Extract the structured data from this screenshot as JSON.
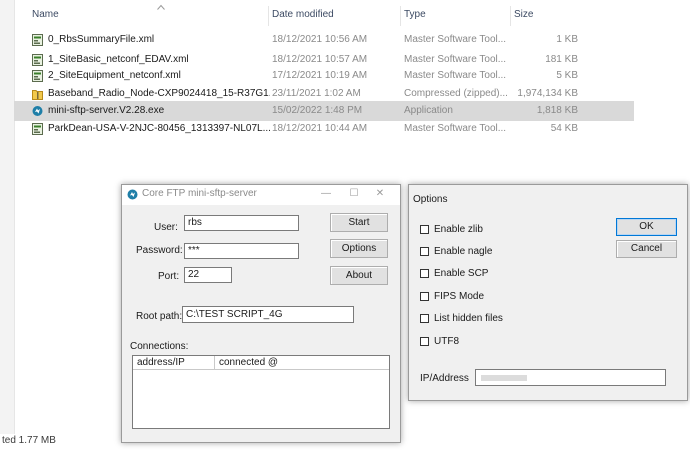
{
  "explorer": {
    "columns": {
      "name": "Name",
      "date": "Date modified",
      "type": "Type",
      "size": "Size"
    },
    "files": [
      {
        "name": "0_RbsSummaryFile.xml",
        "date": "18/12/2021 10:56 AM",
        "type": "Master Software Tool...",
        "size": "1 KB",
        "icon": "xml-file-icon"
      },
      {
        "name": "1_SiteBasic_netconf_EDAV.xml",
        "date": "18/12/2021 10:57 AM",
        "type": "Master Software Tool...",
        "size": "181 KB",
        "icon": "xml-file-icon"
      },
      {
        "name": "2_SiteEquipment_netconf.xml",
        "date": "17/12/2021 10:19 AM",
        "type": "Master Software Tool...",
        "size": "5 KB",
        "icon": "xml-file-icon"
      },
      {
        "name": "Baseband_Radio_Node-CXP9024418_15-R37G1...",
        "date": "23/11/2021 1:02 AM",
        "type": "Compressed (zipped)...",
        "size": "1,974,134 KB",
        "icon": "zip-folder-icon"
      },
      {
        "name": "mini-sftp-server.V2.28.exe",
        "date": "15/02/2022 1:48 PM",
        "type": "Application",
        "size": "1,818 KB",
        "icon": "exe-app-icon"
      },
      {
        "name": "ParkDean-USA-V-2NJC-80456_1313397-NL07L...",
        "date": "18/12/2021 10:44 AM",
        "type": "Master Software Tool...",
        "size": "54 KB",
        "icon": "xml-file-icon"
      }
    ],
    "status_text": "ted  1.77 MB"
  },
  "ftp_dialog": {
    "title": "Core FTP mini-sftp-server",
    "user_label": "User:",
    "user_value": "rbs",
    "password_label": "Password:",
    "password_value": "***",
    "port_label": "Port:",
    "port_value": "22",
    "root_label": "Root path:",
    "root_value": "C:\\TEST SCRIPT_4G",
    "connections_label": "Connections:",
    "col_address": "address/IP",
    "col_connected": "connected @",
    "start_label": "Start",
    "options_label": "Options",
    "about_label": "About"
  },
  "options_dialog": {
    "title": "Options",
    "checkboxes": [
      {
        "label": "Enable zlib",
        "checked": false
      },
      {
        "label": "Enable nagle",
        "checked": false
      },
      {
        "label": "Enable SCP",
        "checked": false
      },
      {
        "label": "FIPS Mode",
        "checked": false
      },
      {
        "label": "List hidden files",
        "checked": false
      },
      {
        "label": "UTF8",
        "checked": false
      }
    ],
    "ok_label": "OK",
    "cancel_label": "Cancel",
    "ip_label": "IP/Address"
  }
}
